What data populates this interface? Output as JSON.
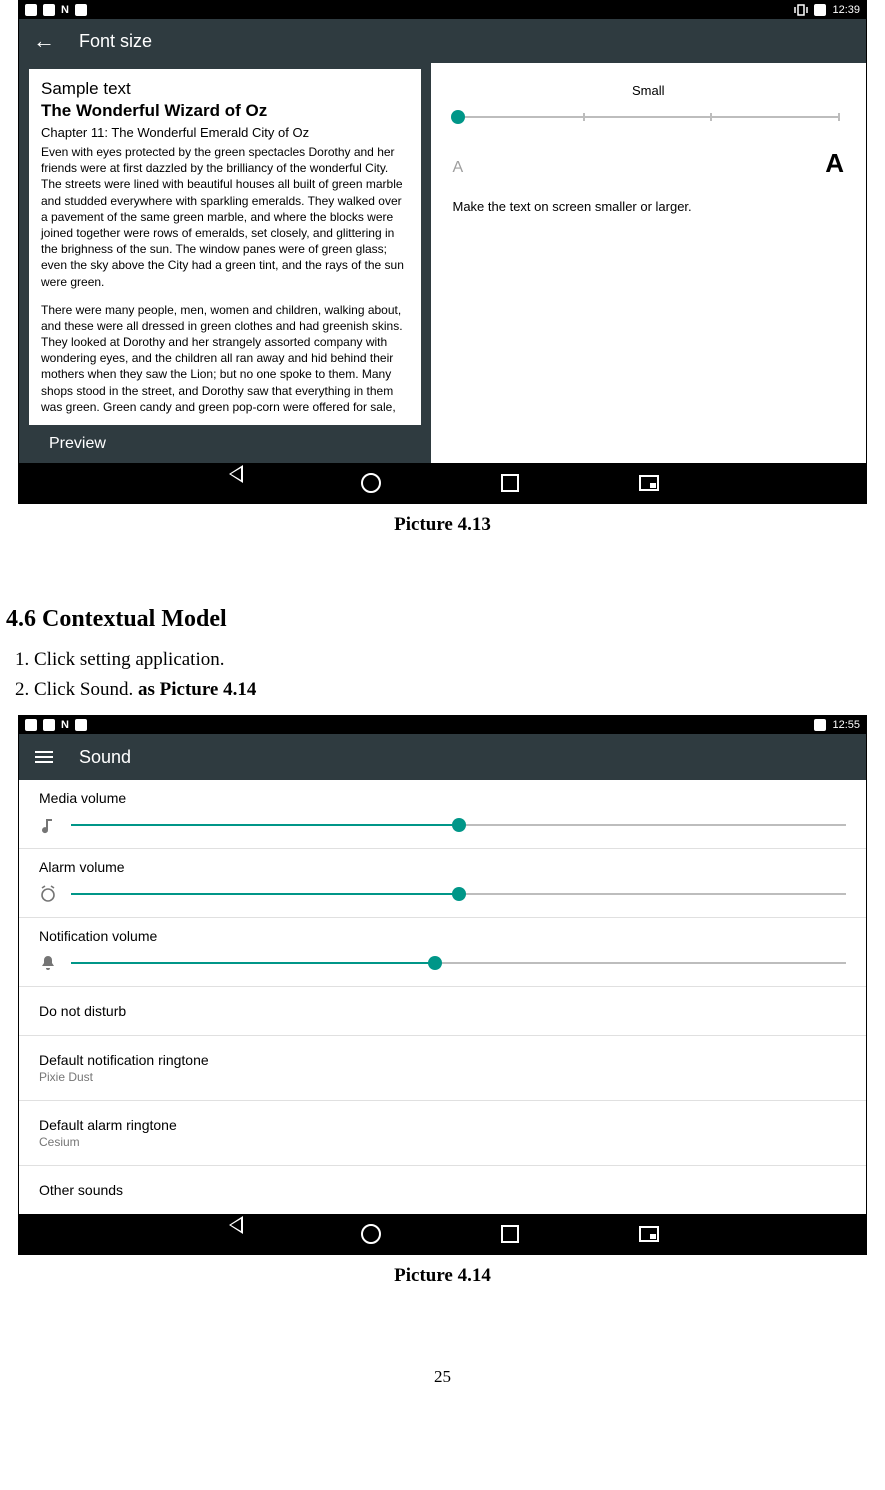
{
  "status": {
    "time1": "12:39",
    "time2": "12:55"
  },
  "shot1": {
    "appbar": {
      "title": "Font size"
    },
    "preview": {
      "sample": "Sample text",
      "title": "The Wonderful Wizard of Oz",
      "chapter": "Chapter 11: The Wonderful Emerald City of Oz",
      "para1": "Even with eyes protected by the green spectacles Dorothy and her friends were at first dazzled by the brilliancy of the wonderful City. The streets were lined with beautiful houses all built of green marble and studded everywhere with sparkling emeralds. They walked over a pavement of the same green marble, and where the blocks were joined together were rows of emeralds, set closely, and glittering in the brighness of the sun. The window panes were of green glass; even the sky above the City had a green tint, and the rays of the sun were green.",
      "para2": "There were many people, men, women and children, walking about, and these were all dressed in green clothes and had greenish skins. They looked at Dorothy and her strangely assorted company with wondering eyes, and the children all ran away and hid behind their mothers when they saw the Lion; but no one spoke to them. Many shops stood in the street, and Dorothy saw that everything in them was green. Green candy and green pop-corn were offered for sale,",
      "label": "Preview"
    },
    "slider_label": "Small",
    "a_small": "A",
    "a_big": "A",
    "hint": "Make the text on screen smaller or larger."
  },
  "caption1": "Picture 4.13",
  "section_title": "4.6 Contextual Model",
  "steps": {
    "s1": "Click setting application.",
    "s2a": "Click Sound. ",
    "s2b": "as Picture 4.14"
  },
  "shot2": {
    "appbar_title": "Sound",
    "rows": {
      "media": "Media volume",
      "alarm": "Alarm volume",
      "notif": "Notification volume",
      "dnd": "Do not disturb",
      "def_notif_t": "Default notification ringtone",
      "def_notif_s": "Pixie Dust",
      "def_alarm_t": "Default alarm ringtone",
      "def_alarm_s": "Cesium",
      "other": "Other sounds"
    }
  },
  "caption2": "Picture 4.14",
  "pagenum": "25"
}
